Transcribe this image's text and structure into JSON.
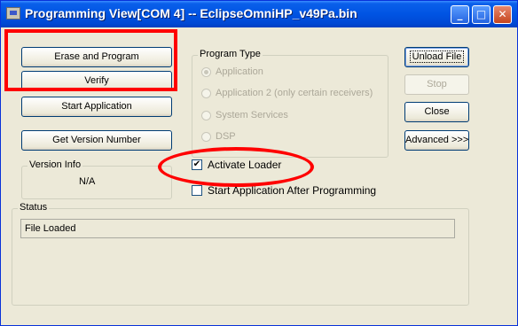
{
  "window": {
    "title": "Programming View[COM 4] -- EclipseOmniHP_v49Pa.bin",
    "minimize_glyph": "_",
    "maximize_glyph": "□",
    "close_glyph": "✕"
  },
  "left_buttons": {
    "erase_program": "Erase and Program",
    "verify": "Verify",
    "start_application": "Start Application",
    "get_version": "Get Version Number"
  },
  "version_info": {
    "label": "Version Info",
    "value": "N/A"
  },
  "program_type": {
    "label": "Program Type",
    "options": [
      {
        "label": "Application",
        "selected": true
      },
      {
        "label": "Application 2 (only certain receivers)",
        "selected": false
      },
      {
        "label": "System Services",
        "selected": false
      },
      {
        "label": "DSP",
        "selected": false
      }
    ]
  },
  "checkboxes": {
    "activate_loader": {
      "label": "Activate Loader",
      "checked": true,
      "mark": "✔"
    },
    "start_after": {
      "label": "Start Application After Programming",
      "checked": false
    }
  },
  "right_buttons": {
    "unload_file": "Unload File",
    "stop": "Stop",
    "close": "Close",
    "advanced": "Advanced >>>"
  },
  "status": {
    "label": "Status",
    "value": "File Loaded"
  },
  "colors": {
    "annotation": "#ff0000",
    "titlebar": "#0054e3",
    "window_bg": "#ece9d8"
  }
}
